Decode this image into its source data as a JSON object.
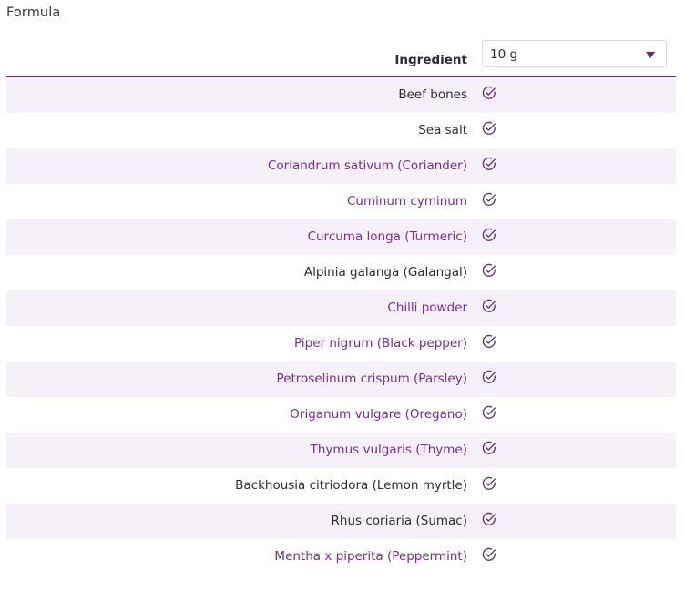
{
  "section_title": "Formula",
  "header": {
    "column_label": "Ingredient",
    "quantity_select": {
      "value": "10 g"
    }
  },
  "colors": {
    "accent": "#6d1f8c",
    "link_text": "#7a2a95",
    "plain_text": "#2b2b33",
    "row_shade": "#f6f1f8"
  },
  "ingredients": [
    {
      "name": "Beef bones",
      "style": "dark",
      "checked": true
    },
    {
      "name": "Sea salt",
      "style": "dark",
      "checked": true
    },
    {
      "name": "Coriandrum sativum (Coriander)",
      "style": "purple",
      "checked": true
    },
    {
      "name": "Cuminum cyminum",
      "style": "purple",
      "checked": true
    },
    {
      "name": "Curcuma longa (Turmeric)",
      "style": "purple",
      "checked": true
    },
    {
      "name": "Alpinia galanga (Galangal)",
      "style": "dark",
      "checked": true
    },
    {
      "name": "Chilli powder",
      "style": "purple",
      "checked": true
    },
    {
      "name": "Piper nigrum (Black pepper)",
      "style": "purple",
      "checked": true
    },
    {
      "name": "Petroselinum crispum (Parsley)",
      "style": "purple",
      "checked": true
    },
    {
      "name": "Origanum vulgare (Oregano)",
      "style": "purple",
      "checked": true
    },
    {
      "name": "Thymus vulgaris (Thyme)",
      "style": "purple",
      "checked": true
    },
    {
      "name": "Backhousia citriodora (Lemon myrtle)",
      "style": "dark",
      "checked": true
    },
    {
      "name": "Rhus coriaria (Sumac)",
      "style": "dark",
      "checked": true
    },
    {
      "name": "Mentha x piperita (Peppermint)",
      "style": "purple",
      "checked": true
    }
  ],
  "icons": {
    "row_status": "check-circle-icon",
    "dropdown": "caret-down-icon"
  }
}
